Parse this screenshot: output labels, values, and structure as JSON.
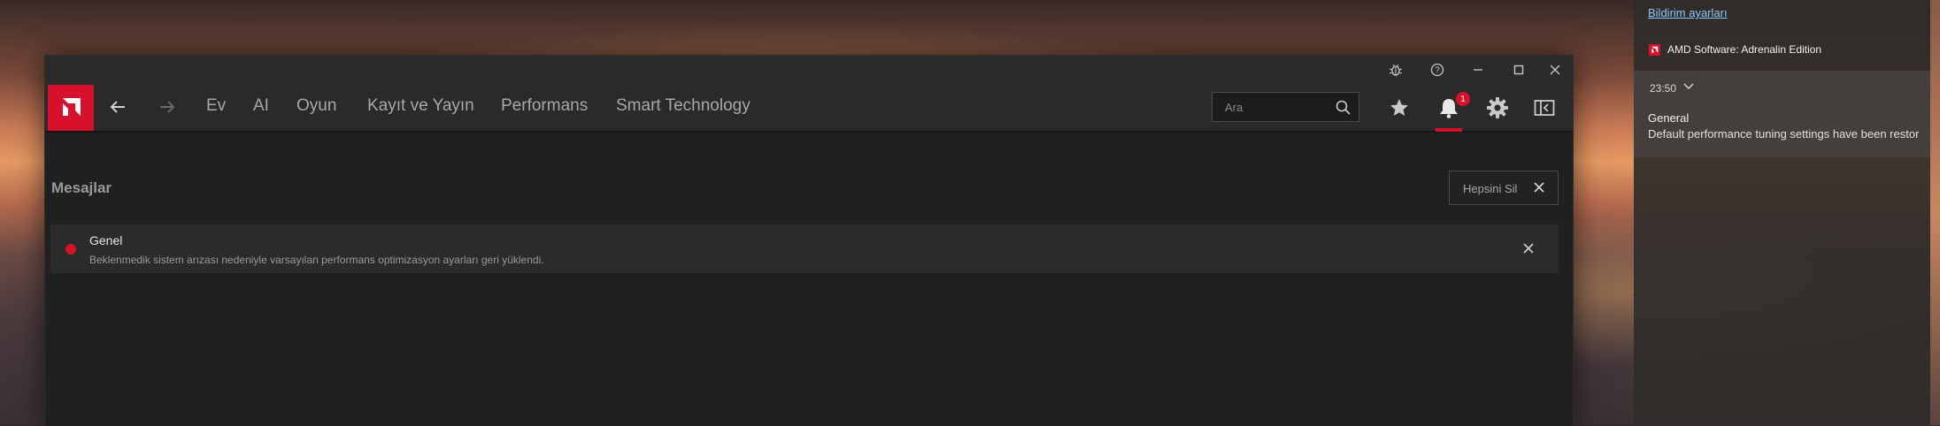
{
  "window": {
    "title_buttons": [
      "bug-report-icon",
      "help-icon",
      "minimize-icon",
      "maximize-icon",
      "close-icon"
    ]
  },
  "nav": {
    "logo": "amd-logo-icon",
    "items": [
      {
        "label": "Ev"
      },
      {
        "label": "AI"
      },
      {
        "label": "Oyun"
      },
      {
        "label": "Kayıt ve Yayın"
      },
      {
        "label": "Performans"
      },
      {
        "label": "Smart Technology"
      }
    ],
    "search_placeholder": "Ara",
    "notification_count": "1",
    "accent_color": "#d7112b"
  },
  "messages": {
    "title": "Mesajlar",
    "clear_all_label": "Hepsini Sil",
    "items": [
      {
        "title": "Genel",
        "body": "Beklenmedik sistem arızası nedeniyle varsayılan performans optimizasyon ayarları geri yüklendi."
      }
    ]
  },
  "notification_center": {
    "settings_link": "Bildirim ayarları",
    "app_name": "AMD Software: Adrenalin Edition",
    "time": "23:50",
    "title": "General",
    "body": "Default performance tuning settings have been restored due to an unexpected system failure."
  }
}
